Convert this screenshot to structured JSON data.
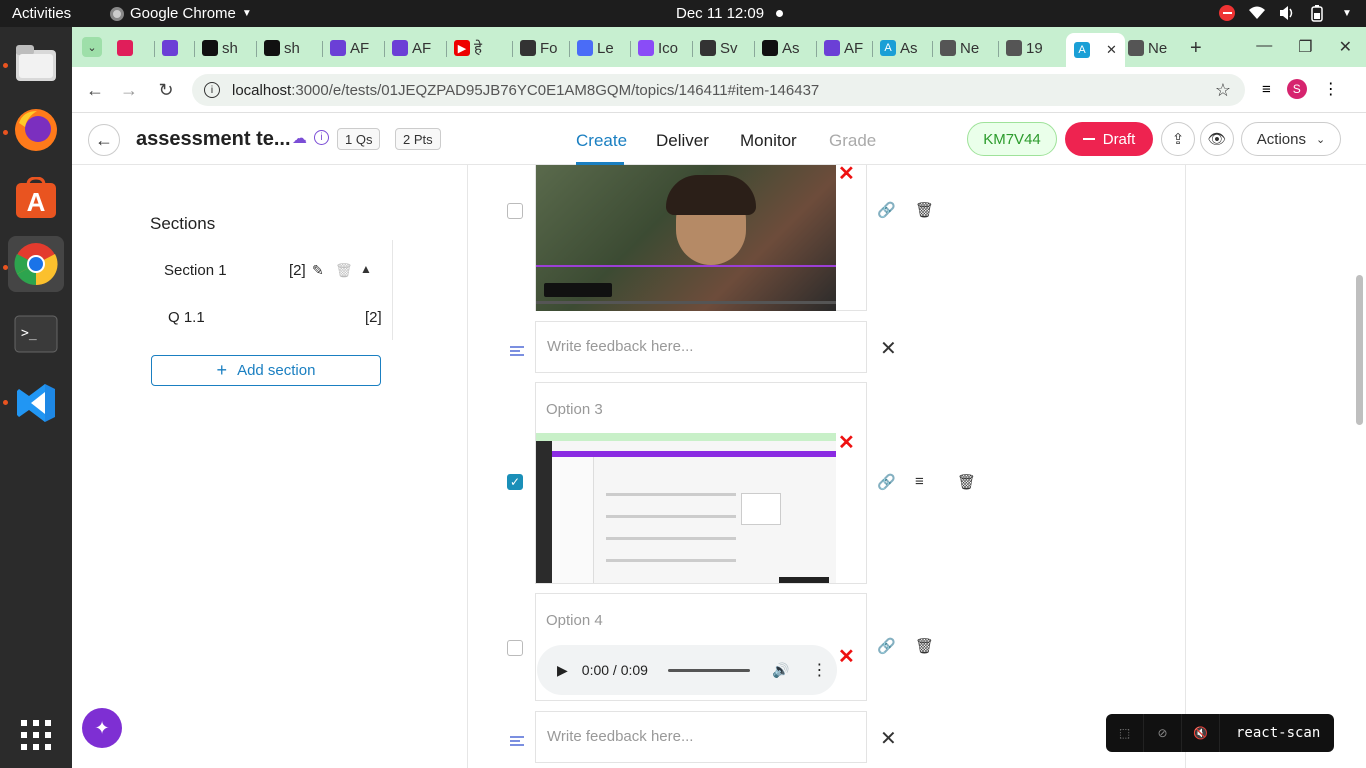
{
  "system": {
    "activities": "Activities",
    "app_name": "Google Chrome",
    "clock": "Dec 11  12:09"
  },
  "browser": {
    "tabs": [
      {
        "label": "",
        "icon": "slack",
        "color": "#e01e5a"
      },
      {
        "label": "",
        "icon": "arc",
        "color": "#6b3fd6"
      },
      {
        "label": "sh",
        "icon": "github",
        "color": "#111"
      },
      {
        "label": "sh",
        "icon": "github",
        "color": "#111"
      },
      {
        "label": "AF",
        "icon": "arc",
        "color": "#6b3fd6"
      },
      {
        "label": "AF",
        "icon": "arc",
        "color": "#6b3fd6"
      },
      {
        "label": "हे",
        "icon": "youtube",
        "color": "#e00"
      },
      {
        "label": "Fo",
        "icon": "chatgpt",
        "color": "#333"
      },
      {
        "label": "Le",
        "icon": "diamond",
        "color": "#4a6cf7"
      },
      {
        "label": "Ico",
        "icon": "diamond",
        "color": "#8a4cf7"
      },
      {
        "label": "Sv",
        "icon": "chatgpt",
        "color": "#333"
      },
      {
        "label": "As",
        "icon": "github",
        "color": "#111"
      },
      {
        "label": "AF",
        "icon": "arc",
        "color": "#6b3fd6"
      },
      {
        "label": "As",
        "icon": "a-app",
        "color": "#1a9fd6"
      },
      {
        "label": "Ne",
        "icon": "chrome",
        "color": "#555"
      },
      {
        "label": "19",
        "icon": "globe",
        "color": "#555"
      },
      {
        "label": "",
        "icon": "a-app",
        "color": "#1a9fd6",
        "active": true
      },
      {
        "label": "Ne",
        "icon": "chrome",
        "color": "#555"
      }
    ],
    "url_host": "localhost",
    "url_path": ":3000/e/tests/01JEQZPAD95JB76YC0E1AM8GQM/topics/146411#item-146437",
    "profile_initial": "S"
  },
  "header": {
    "title": "assessment te...",
    "qs_chip": "1 Qs",
    "pts_chip": "2 Pts",
    "tabs": {
      "create": "Create",
      "deliver": "Deliver",
      "monitor": "Monitor",
      "grade": "Grade"
    },
    "code": "KM7V44",
    "draft": "Draft",
    "actions": "Actions"
  },
  "sidebar": {
    "heading": "Sections",
    "section_name": "Section 1",
    "section_count": "[2]",
    "question_name": "Q 1.1",
    "question_count": "[2]",
    "add_section": "Add section"
  },
  "main": {
    "feedback_placeholder": "Write feedback here...",
    "option3_label": "Option 3",
    "option4_label": "Option 4",
    "audio_time": "0:00 / 0:09",
    "option3_checked": true
  },
  "reactscan": {
    "label": "react-scan"
  },
  "colors": {
    "accent": "#1a7fc1",
    "draft": "#ee2350",
    "code_green": "#2c9b2c",
    "tabstrip": "#c7efd0"
  }
}
